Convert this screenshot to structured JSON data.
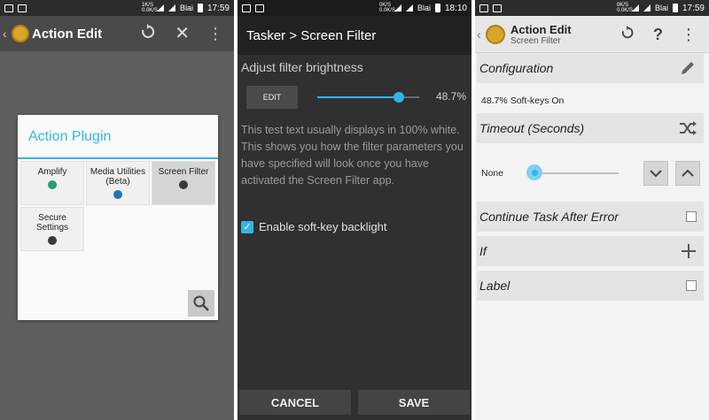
{
  "panel1": {
    "statusbar": {
      "carrier": "Blai",
      "time": "17:59",
      "signal_text": "1K/S 0.0K/S"
    },
    "actionbar": {
      "title": "Action Edit"
    },
    "dialog": {
      "title": "Action Plugin",
      "items": [
        {
          "label": "Amplify",
          "icon": "amplify-icon",
          "color": "#20a070"
        },
        {
          "label": "Media Utilities (Beta)",
          "icon": "media-utilities-icon",
          "color": "#1e73be"
        },
        {
          "label": "Screen Filter",
          "icon": "screen-filter-icon",
          "color": "#3a3a3a"
        },
        {
          "label": "Secure Settings",
          "icon": "secure-settings-icon",
          "color": "#3a3a3a"
        }
      ]
    }
  },
  "panel2": {
    "statusbar": {
      "carrier": "Blai",
      "time": "18:10",
      "signal_text": "0K/S 0.0K/S"
    },
    "actionbar": {
      "title": "Tasker > Screen Filter"
    },
    "adjust_label": "Adjust filter brightness",
    "edit_button": "EDIT",
    "brightness": {
      "value": 48.7,
      "label": "48.7%"
    },
    "description": "This test text usually displays in 100% white. This shows you how the filter parameters you have specified will look once you have activated the Screen Filter app.",
    "checkbox": {
      "label": "Enable soft-key backlight",
      "checked": true
    },
    "buttons": {
      "cancel": "CANCEL",
      "save": "SAVE"
    },
    "accent": "#33b5e5"
  },
  "panel3": {
    "statusbar": {
      "carrier": "Blai",
      "time": "17:59",
      "signal_text": "0K/S 0.0K/S"
    },
    "actionbar": {
      "title": "Action Edit",
      "subtitle": "Screen Filter"
    },
    "configuration": {
      "title": "Configuration",
      "value": "48.7% Soft-keys On"
    },
    "timeout": {
      "title": "Timeout (Seconds)",
      "value_label": "None",
      "value": 0
    },
    "continue_after_error": {
      "title": "Continue Task After Error",
      "checked": false
    },
    "if": {
      "title": "If"
    },
    "label": {
      "title": "Label",
      "checked": false
    }
  }
}
